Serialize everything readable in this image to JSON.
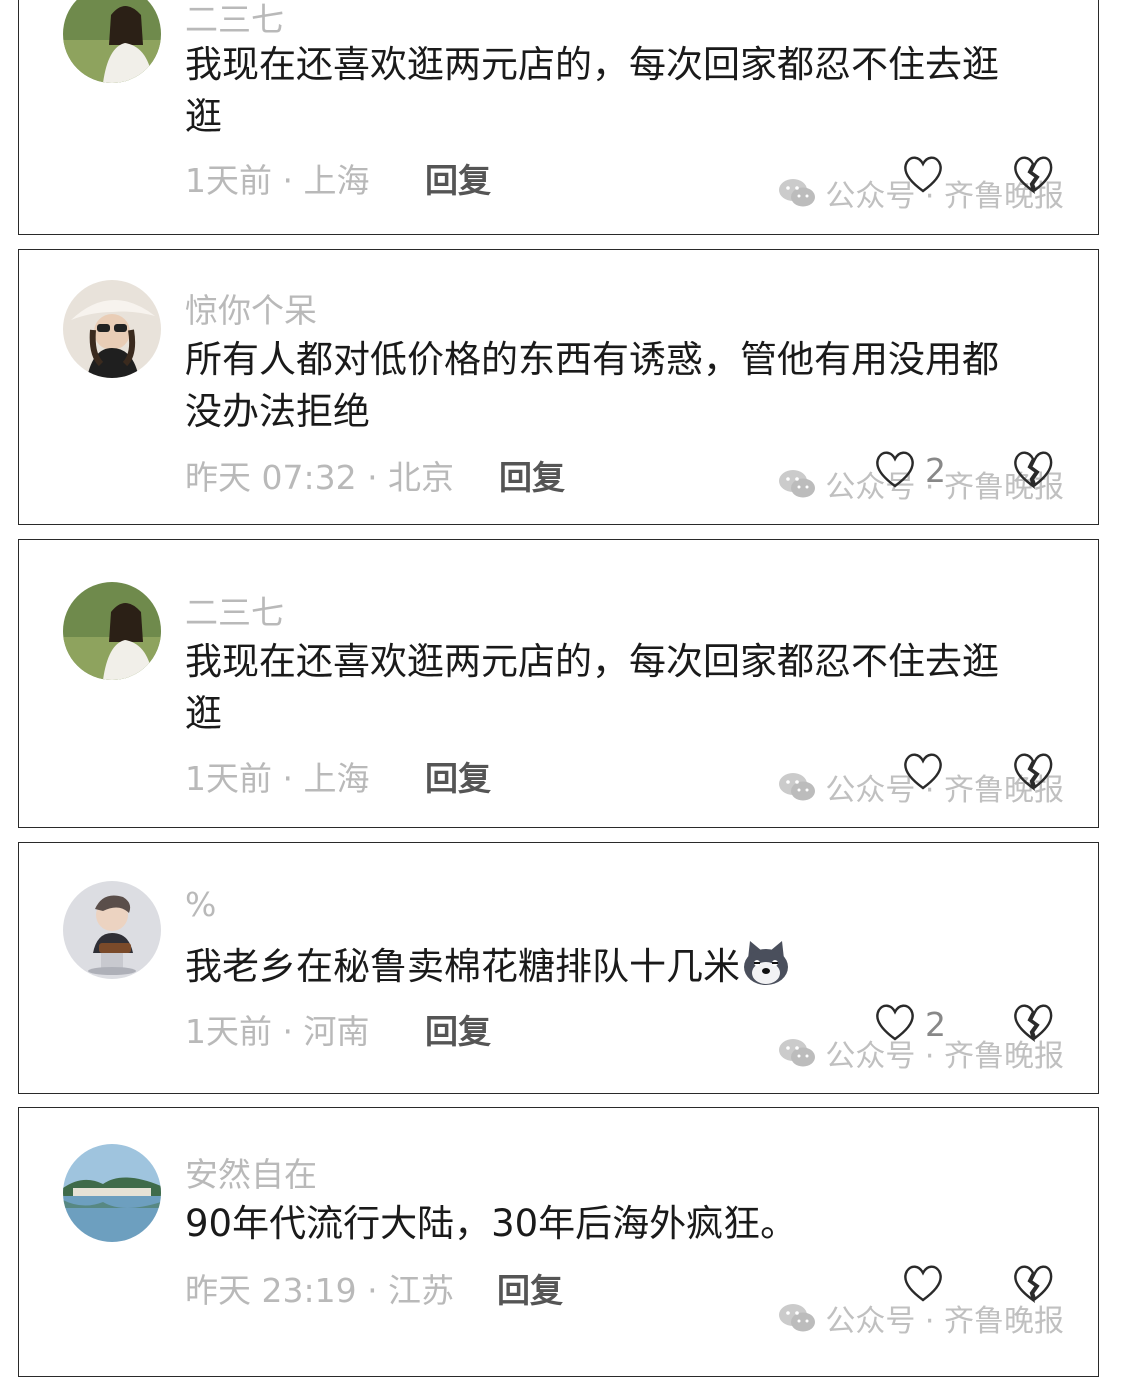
{
  "comments": [
    {
      "username": "二三七",
      "text": "我现在还喜欢逛两元店的，每次回家都忍不住去逛逛",
      "time_location": "1天前 · 上海",
      "reply_label": "回复",
      "likes": ""
    },
    {
      "username": "惊你个呆",
      "text": "所有人都对低价格的东西有诱惑，管他有用没用都没办法拒绝",
      "time_location": "昨天 07:32 · 北京",
      "reply_label": "回复",
      "likes": "2"
    },
    {
      "username": "二三七",
      "text": "我现在还喜欢逛两元店的，每次回家都忍不住去逛逛",
      "time_location": "1天前 · 上海",
      "reply_label": "回复",
      "likes": ""
    },
    {
      "username": "%",
      "text": "我老乡在秘鲁卖棉花糖排队十几米",
      "time_location": "1天前 · 河南",
      "reply_label": "回复",
      "likes": "2"
    },
    {
      "username": "安然自在",
      "text": "90年代流行大陆，30年后海外疯狂。",
      "time_location": "昨天 23:19 · 江苏",
      "reply_label": "回复",
      "likes": ""
    }
  ],
  "watermark": {
    "text": "公众号 · 齐鲁晚报"
  },
  "icons": {
    "like": "heart-outline-icon",
    "dislike": "broken-heart-icon",
    "emoji": "dog-emoji-icon",
    "wechat": "wechat-logo-icon"
  },
  "colors": {
    "username": "#b9b9b9",
    "comment_text": "#1a1a1a",
    "meta": "#b9b9b9",
    "reply": "#555555",
    "border": "#2a2a2a"
  }
}
